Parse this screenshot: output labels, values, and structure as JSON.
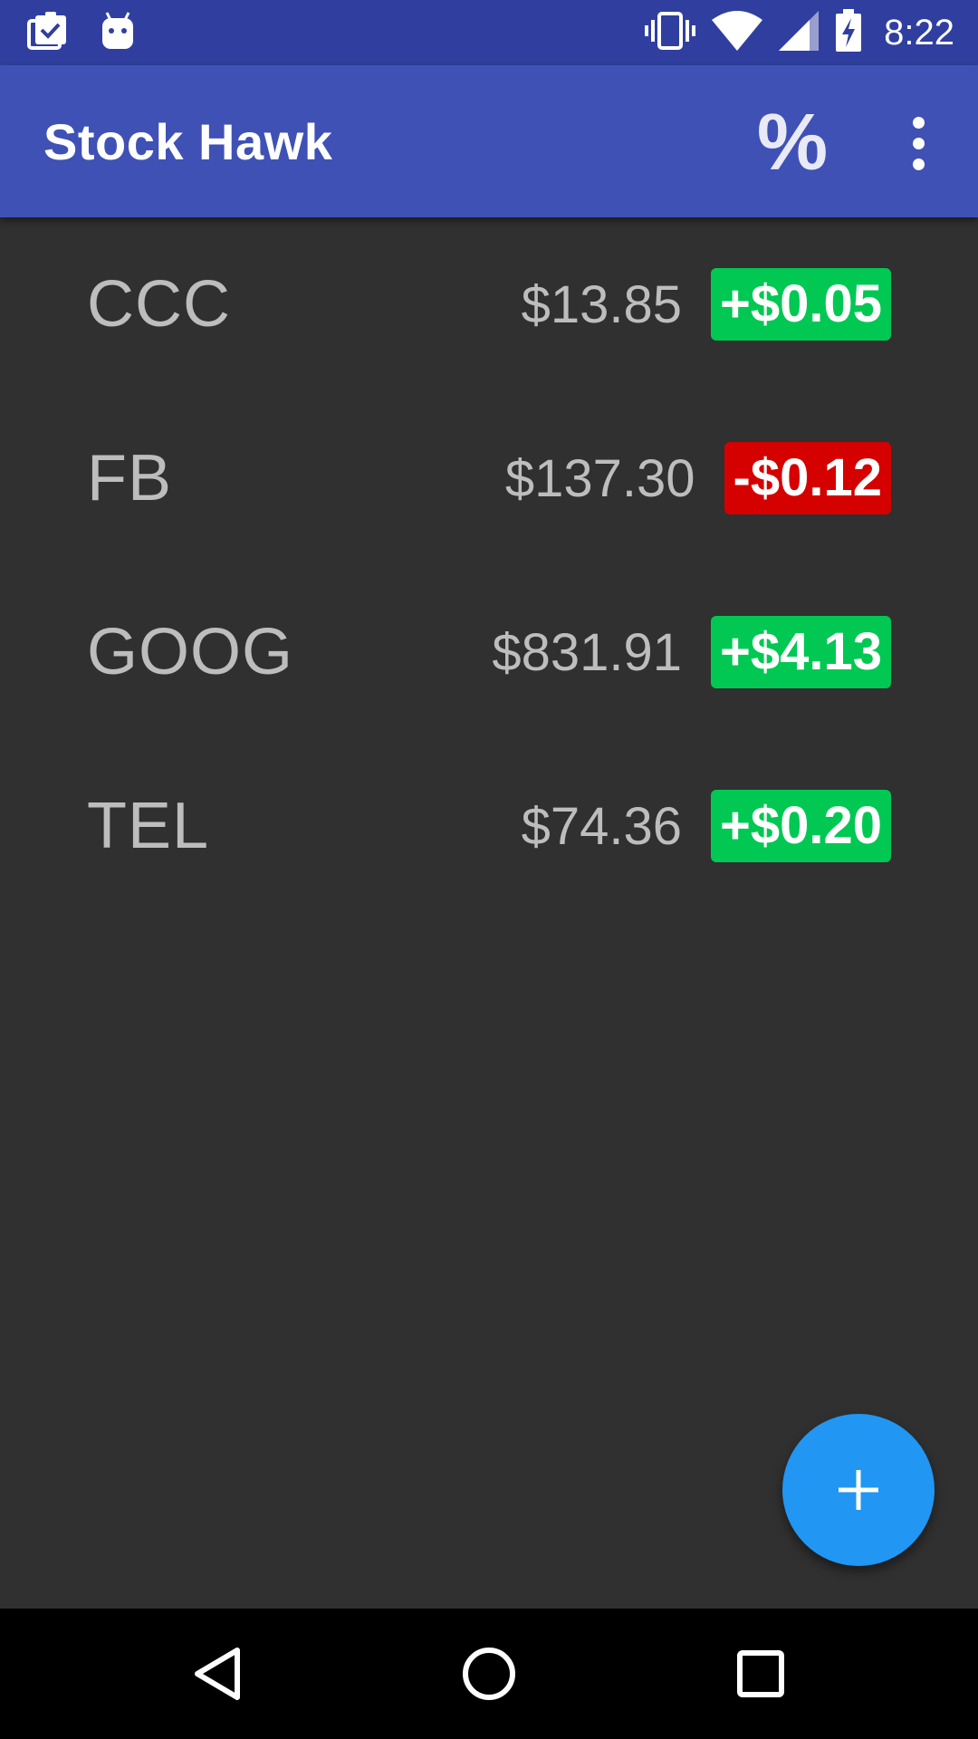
{
  "status_bar": {
    "time": "8:22",
    "icons": [
      "clipboard-check-icon",
      "android-icon",
      "vibrate-icon",
      "wifi-icon",
      "signal-icon",
      "battery-charging-icon"
    ],
    "background": "#303F9F"
  },
  "app_bar": {
    "title": "Stock Hawk",
    "percent_label": "%",
    "background": "#3F51B5"
  },
  "stocks": [
    {
      "symbol": "CCC",
      "price": "$13.85",
      "change": "+$0.05",
      "direction": "up"
    },
    {
      "symbol": "FB",
      "price": "$137.30",
      "change": "-$0.12",
      "direction": "down"
    },
    {
      "symbol": "GOOG",
      "price": "$831.91",
      "change": "+$4.13",
      "direction": "up"
    },
    {
      "symbol": "TEL",
      "price": "$74.36",
      "change": "+$0.20",
      "direction": "up"
    }
  ],
  "colors": {
    "up": "#00C853",
    "down": "#D50000",
    "fab": "#2196F3",
    "background": "#303030"
  },
  "fab": {
    "icon": "plus-icon"
  },
  "nav_bar": {
    "icons": [
      "back-icon",
      "home-icon",
      "recents-icon"
    ]
  }
}
